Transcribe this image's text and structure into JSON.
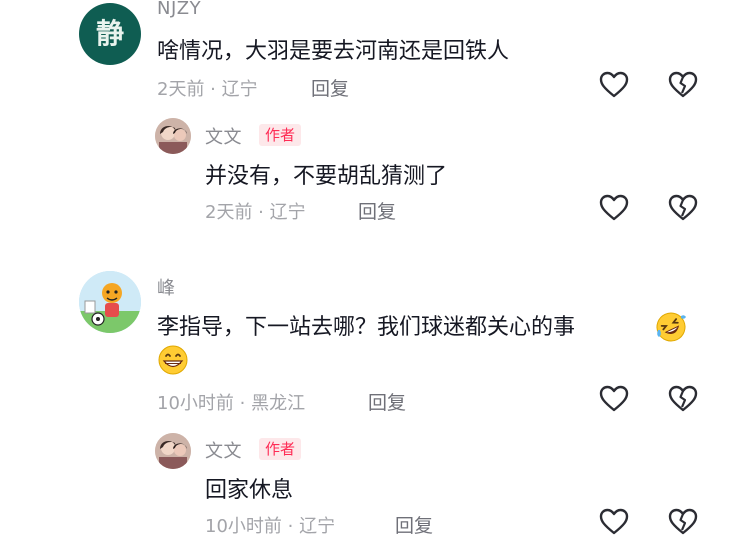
{
  "comments": [
    {
      "username": "NJZY",
      "avatar_text": "静",
      "text": "啥情况，大羽是要去河南还是回铁人",
      "meta": "2天前 · 辽宁",
      "reply_label": "回复",
      "reply": {
        "username": "文文",
        "badge": "作者",
        "text": "并没有，不要胡乱猜测了",
        "meta": "2天前 · 辽宁",
        "reply_label": "回复"
      }
    },
    {
      "username": "峰",
      "text": "李指导，下一站去哪？我们球迷都关心的事",
      "meta": "10小时前 · 黑龙江",
      "reply_label": "回复",
      "reply": {
        "username": "文文",
        "badge": "作者",
        "text": "回家休息",
        "meta": "10小时前 · 辽宁",
        "reply_label": "回复"
      }
    }
  ],
  "icons": {
    "like": "heart-outline-icon",
    "dislike": "broken-heart-icon",
    "emoji_rofl": "rolling-laughing-emoji",
    "emoji_grin": "grinning-emoji"
  },
  "colors": {
    "badge_text": "#fe2c55",
    "badge_bg": "#fde8ea",
    "meta_text": "#a3a4a9",
    "body_text": "#161823"
  }
}
